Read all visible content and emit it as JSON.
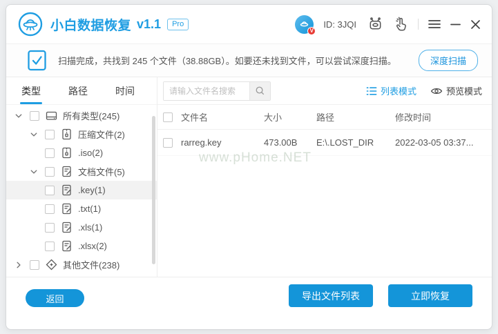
{
  "window": {
    "title": "小白数据恢复",
    "version": "v1.1",
    "badge": "Pro",
    "user_id": "ID: 3JQI"
  },
  "banner": {
    "text": "扫描完成，共找到 245 个文件（38.88GB）。如要还未找到文件，可以尝试深度扫描。",
    "deep_scan_label": "深度扫描"
  },
  "sidebar": {
    "tabs": [
      {
        "label": "类型",
        "active": true
      },
      {
        "label": "路径",
        "active": false
      },
      {
        "label": "时间",
        "active": false
      }
    ],
    "tree": [
      {
        "label": "所有类型(245)",
        "level": 0,
        "icon": "drive-icon",
        "expanded": true,
        "selected": false
      },
      {
        "label": "压缩文件(2)",
        "level": 1,
        "icon": "archive-icon",
        "expanded": true,
        "selected": false
      },
      {
        "label": ".iso(2)",
        "level": 2,
        "icon": "archive-icon",
        "selected": false
      },
      {
        "label": "文档文件(5)",
        "level": 1,
        "icon": "document-icon",
        "expanded": true,
        "selected": false
      },
      {
        "label": ".key(1)",
        "level": 2,
        "icon": "document-icon",
        "selected": true
      },
      {
        "label": ".txt(1)",
        "level": 2,
        "icon": "document-icon",
        "selected": false
      },
      {
        "label": ".xls(1)",
        "level": 2,
        "icon": "document-icon",
        "selected": false
      },
      {
        "label": ".xlsx(2)",
        "level": 2,
        "icon": "document-icon",
        "selected": false
      },
      {
        "label": "其他文件(238)",
        "level": 0,
        "icon": "other-files-icon",
        "expanded": false,
        "selected": false
      }
    ]
  },
  "toolbar": {
    "search_placeholder": "请输入文件名搜索",
    "list_mode_label": "列表模式",
    "preview_mode_label": "预览模式"
  },
  "table": {
    "headers": [
      "文件名",
      "大小",
      "路径",
      "修改时间"
    ],
    "rows": [
      {
        "name": "rarreg.key",
        "size": "473.00B",
        "path": "E:\\.LOST_DIR",
        "modified": "2022-03-05 03:37..."
      }
    ]
  },
  "watermark": "www.pHome.NET",
  "footer": {
    "back_label": "返回",
    "export_label": "导出文件列表",
    "recover_label": "立即恢复"
  },
  "colors": {
    "accent": "#1495d9",
    "title_blue": "#1e9de2",
    "selected_row_bg": "#f2f2f2",
    "badge_red": "#e83c36"
  }
}
